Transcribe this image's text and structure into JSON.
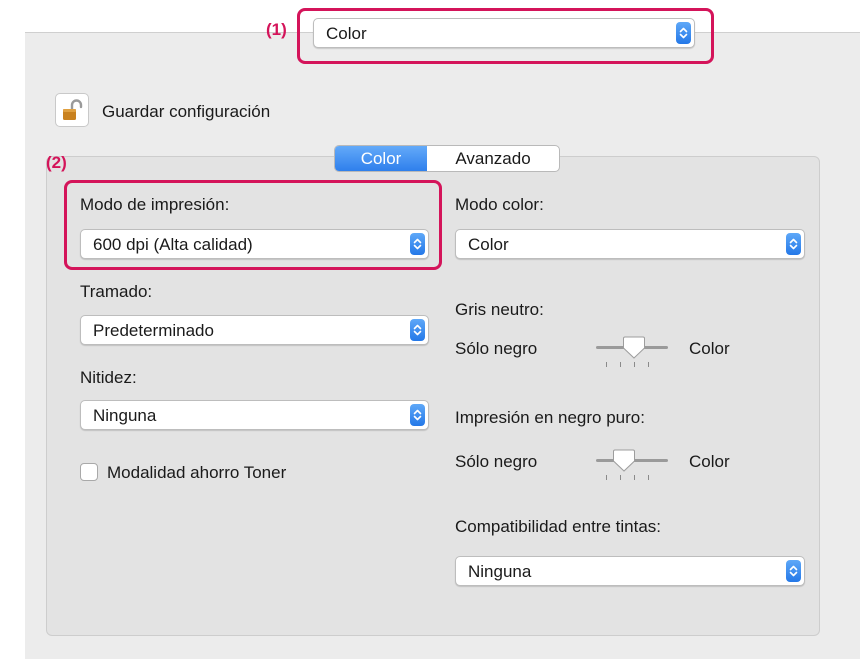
{
  "callouts": {
    "one": "(1)",
    "two": "(2)"
  },
  "top_popup": {
    "value": "Color"
  },
  "save_settings": {
    "label": "Guardar configuración"
  },
  "tabs": [
    {
      "label": "Color",
      "selected": true
    },
    {
      "label": "Avanzado",
      "selected": false
    }
  ],
  "left": {
    "print_mode_label": "Modo de impresión:",
    "print_mode_value": "600 dpi (Alta calidad)",
    "screening_label": "Tramado:",
    "screening_value": "Predeterminado",
    "sharpness_label": "Nitidez:",
    "sharpness_value": "Ninguna",
    "toner_save_label": "Modalidad ahorro Toner",
    "toner_save_checked": false
  },
  "right": {
    "color_mode_label": "Modo color:",
    "color_mode_value": "Color",
    "neutral_gray_label": "Gris neutro:",
    "neutral_gray_min": "Sólo negro",
    "neutral_gray_max": "Color",
    "pure_black_label": "Impresión en negro puro:",
    "pure_black_min": "Sólo negro",
    "pure_black_max": "Color",
    "ink_compat_label": "Compatibilidad entre tintas:",
    "ink_compat_value": "Ninguna"
  },
  "colors": {
    "callout": "#d4145a",
    "accent": "#2f7fec",
    "panel": "#e3e3e3",
    "window": "#ececec"
  },
  "icons": {
    "lock": "unlocked-padlock-icon",
    "stepper": "up-down-chevron-icon"
  }
}
